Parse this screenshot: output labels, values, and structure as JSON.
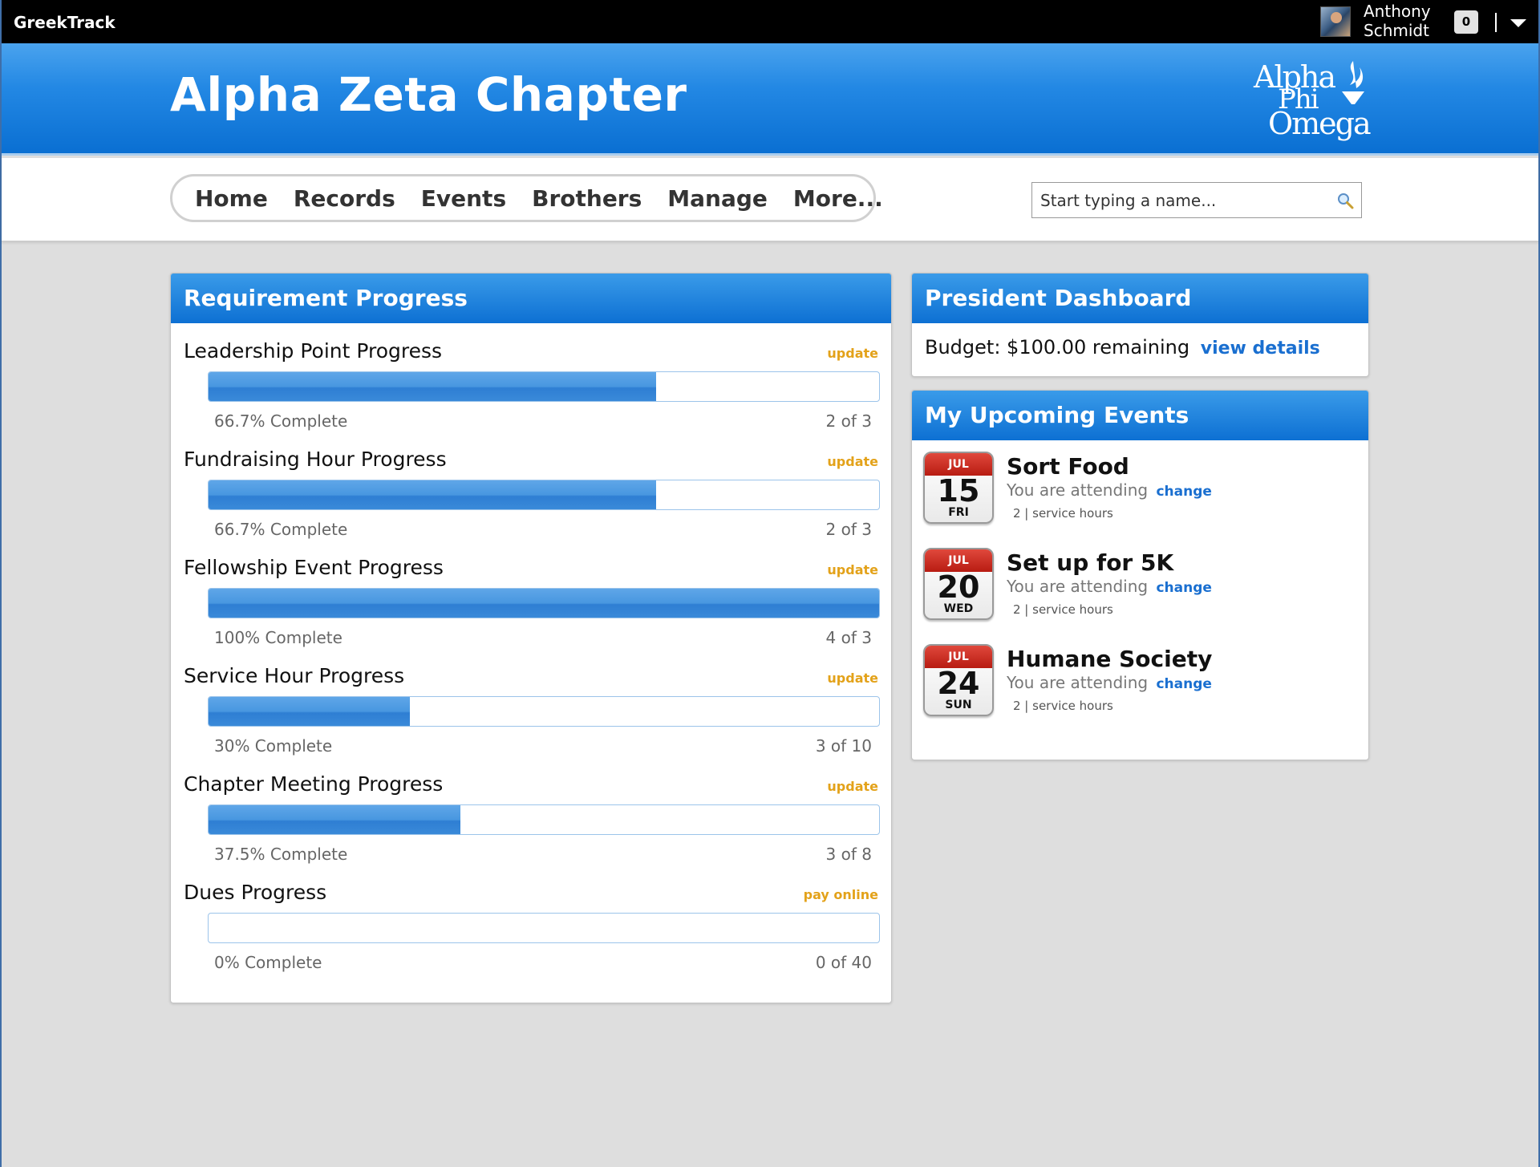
{
  "app": {
    "name": "GreekTrack"
  },
  "user": {
    "first_name": "Anthony",
    "last_name": "Schmidt",
    "notification_count": "0"
  },
  "banner": {
    "chapter_title": "Alpha Zeta Chapter",
    "logo_line1": "Alpha",
    "logo_line2": "Phi",
    "logo_line3": "Omega"
  },
  "nav": {
    "items": [
      {
        "label": "Home"
      },
      {
        "label": "Records"
      },
      {
        "label": "Events"
      },
      {
        "label": "Brothers"
      },
      {
        "label": "Manage"
      },
      {
        "label": "More..."
      }
    ]
  },
  "search": {
    "placeholder": "Start typing a name..."
  },
  "requirements": {
    "title": "Requirement Progress",
    "items": [
      {
        "title": "Leadership Point Progress",
        "action": "update",
        "percent_label": "66.7% Complete",
        "count": "2 of 3",
        "fraction": 0.667
      },
      {
        "title": "Fundraising Hour Progress",
        "action": "update",
        "percent_label": "66.7% Complete",
        "count": "2 of 3",
        "fraction": 0.667
      },
      {
        "title": "Fellowship Event Progress",
        "action": "update",
        "percent_label": "100% Complete",
        "count": "4 of 3",
        "fraction": 1.0
      },
      {
        "title": "Service Hour Progress",
        "action": "update",
        "percent_label": "30% Complete",
        "count": "3 of 10",
        "fraction": 0.3
      },
      {
        "title": "Chapter Meeting Progress",
        "action": "update",
        "percent_label": "37.5% Complete",
        "count": "3 of 8",
        "fraction": 0.375
      },
      {
        "title": "Dues Progress",
        "action": "pay online",
        "percent_label": "0% Complete",
        "count": "0 of 40",
        "fraction": 0.0
      }
    ]
  },
  "president": {
    "title": "President Dashboard",
    "budget_label": "Budget:",
    "budget_value": "$100.00 remaining",
    "view_details": "view details"
  },
  "events": {
    "title": "My Upcoming Events",
    "items": [
      {
        "month": "JUL",
        "day": "15",
        "weekday": "FRI",
        "title": "Sort Food",
        "status": "You are attending",
        "change": "change",
        "hours": "2 | service hours"
      },
      {
        "month": "JUL",
        "day": "20",
        "weekday": "WED",
        "title": "Set up for 5K",
        "status": "You are attending",
        "change": "change",
        "hours": "2 | service hours"
      },
      {
        "month": "JUL",
        "day": "24",
        "weekday": "SUN",
        "title": "Humane Society",
        "status": "You are attending",
        "change": "change",
        "hours": "2 | service hours"
      }
    ]
  },
  "colors": {
    "accent_blue": "#0d70d3",
    "link_blue": "#1a6fd0",
    "action_orange": "#e3a21a",
    "calendar_red": "#b81c12"
  }
}
